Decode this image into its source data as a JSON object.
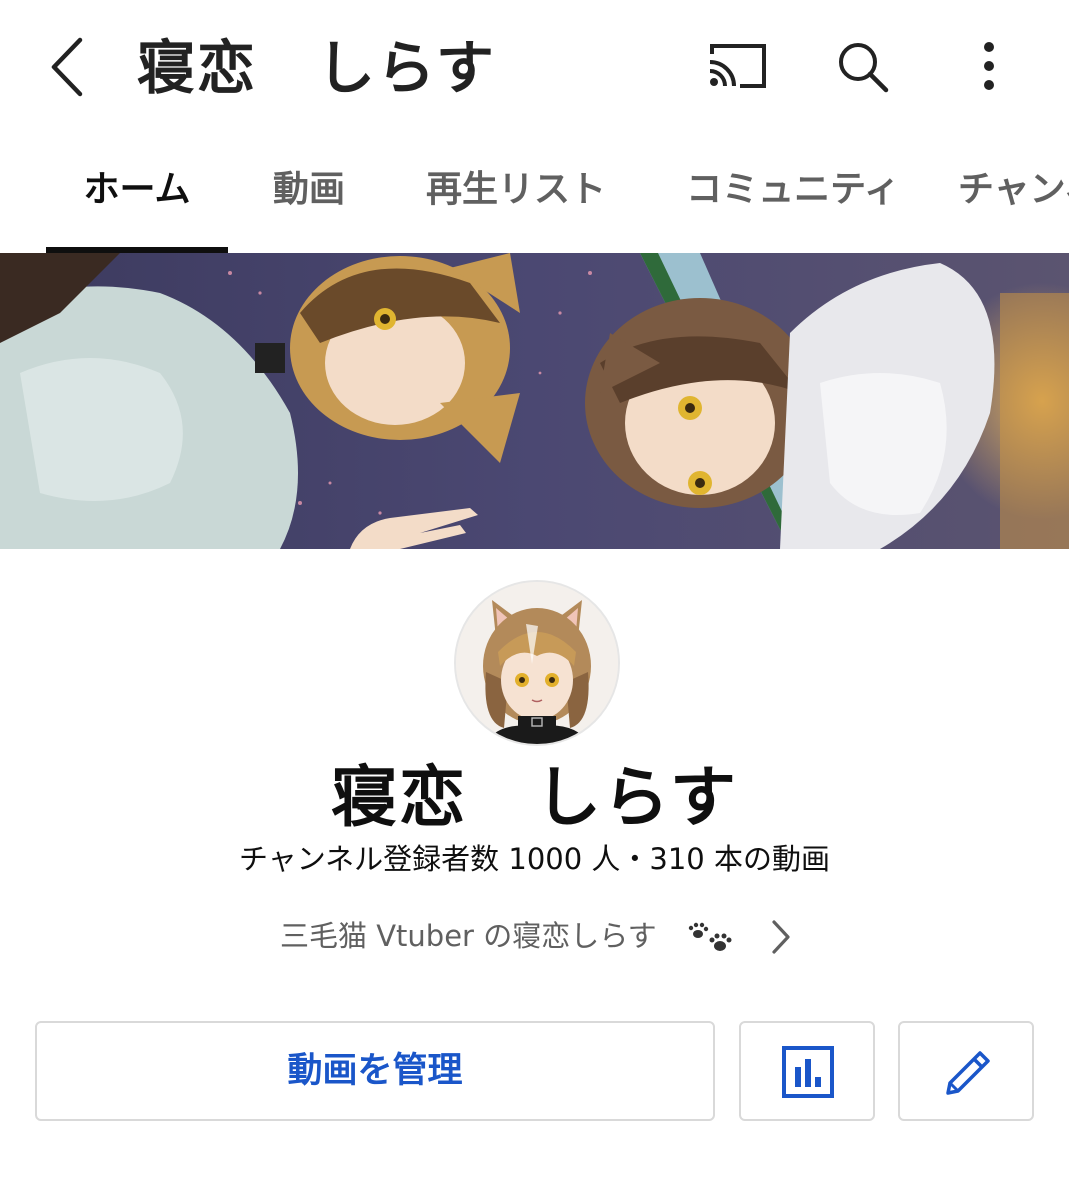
{
  "header": {
    "title": "寝恋　しらす",
    "icons": [
      "back-icon",
      "cast-icon",
      "search-icon",
      "more-vert-icon"
    ]
  },
  "tabs": [
    {
      "label": "ホーム",
      "active": true
    },
    {
      "label": "動画",
      "active": false
    },
    {
      "label": "再生リスト",
      "active": false
    },
    {
      "label": "コミュニティ",
      "active": false
    },
    {
      "label": "チャンネル",
      "active": false
    }
  ],
  "channel": {
    "name": "寝恋　しらす",
    "stats": "チャンネル登録者数 1000 人・310 本の動画",
    "description": "三毛猫 Vtuber の寝恋しらす"
  },
  "actions": {
    "manage_videos_label": "動画を管理",
    "analytics_icon": "analytics-icon",
    "edit_icon": "pencil-icon"
  },
  "colors": {
    "accent": "#1a56c9",
    "text_primary": "#0f0f0f",
    "text_secondary": "#606060",
    "banner_bg": "#4a4770"
  }
}
